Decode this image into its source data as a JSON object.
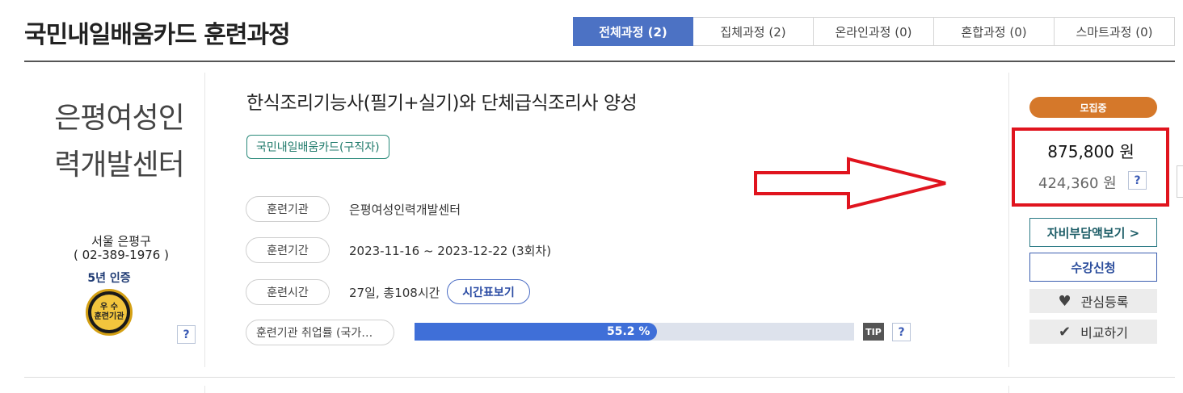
{
  "header": {
    "title": "국민내일배움카드 훈련과정",
    "tabs": [
      {
        "label": "전체과정 (2)",
        "active": true
      },
      {
        "label": "집체과정 (2)",
        "active": false
      },
      {
        "label": "온라인과정 (0)",
        "active": false
      },
      {
        "label": "혼합과정 (0)",
        "active": false
      },
      {
        "label": "스마트과정 (0)",
        "active": false
      }
    ]
  },
  "institution": {
    "name_line1": "은평여성인",
    "name_line2": "력개발센터",
    "region": "서울 은평구",
    "phone": "( 02-389-1976 )",
    "certification": "5년 인증",
    "badge_line1": "우 수",
    "badge_line2": "훈련기관",
    "help_label": "?"
  },
  "course": {
    "title": "한식조리기능사(필기+실기)와 단체급식조리사 양성",
    "card_tag": "국민내일배움카드(구직자)",
    "rows": {
      "institution_label": "훈련기관",
      "institution_value": "은평여성인력개발센터",
      "period_label": "훈련기간",
      "period_value": "2023-11-16 ~ 2023-12-22 (3회차)",
      "hours_label": "훈련시간",
      "hours_value": "27일, 총108시간",
      "schedule_button": "시간표보기"
    },
    "employment": {
      "label": "훈련기관 취업률 (국가…",
      "rate_text": "55.2 %",
      "rate": 0.552,
      "tip": "TIP",
      "help": "?"
    }
  },
  "pricing": {
    "status": "모집중",
    "status_color": "#d5782a",
    "price": "875,800 원",
    "self_pay": "424,360 원",
    "help": "?",
    "highlight_color": "#e0141e"
  },
  "actions": {
    "self_pay_button": "자비부담액보기 >",
    "apply_button": "수강신청",
    "wishlist_button": "관심등록",
    "compare_button": "비교하기"
  }
}
